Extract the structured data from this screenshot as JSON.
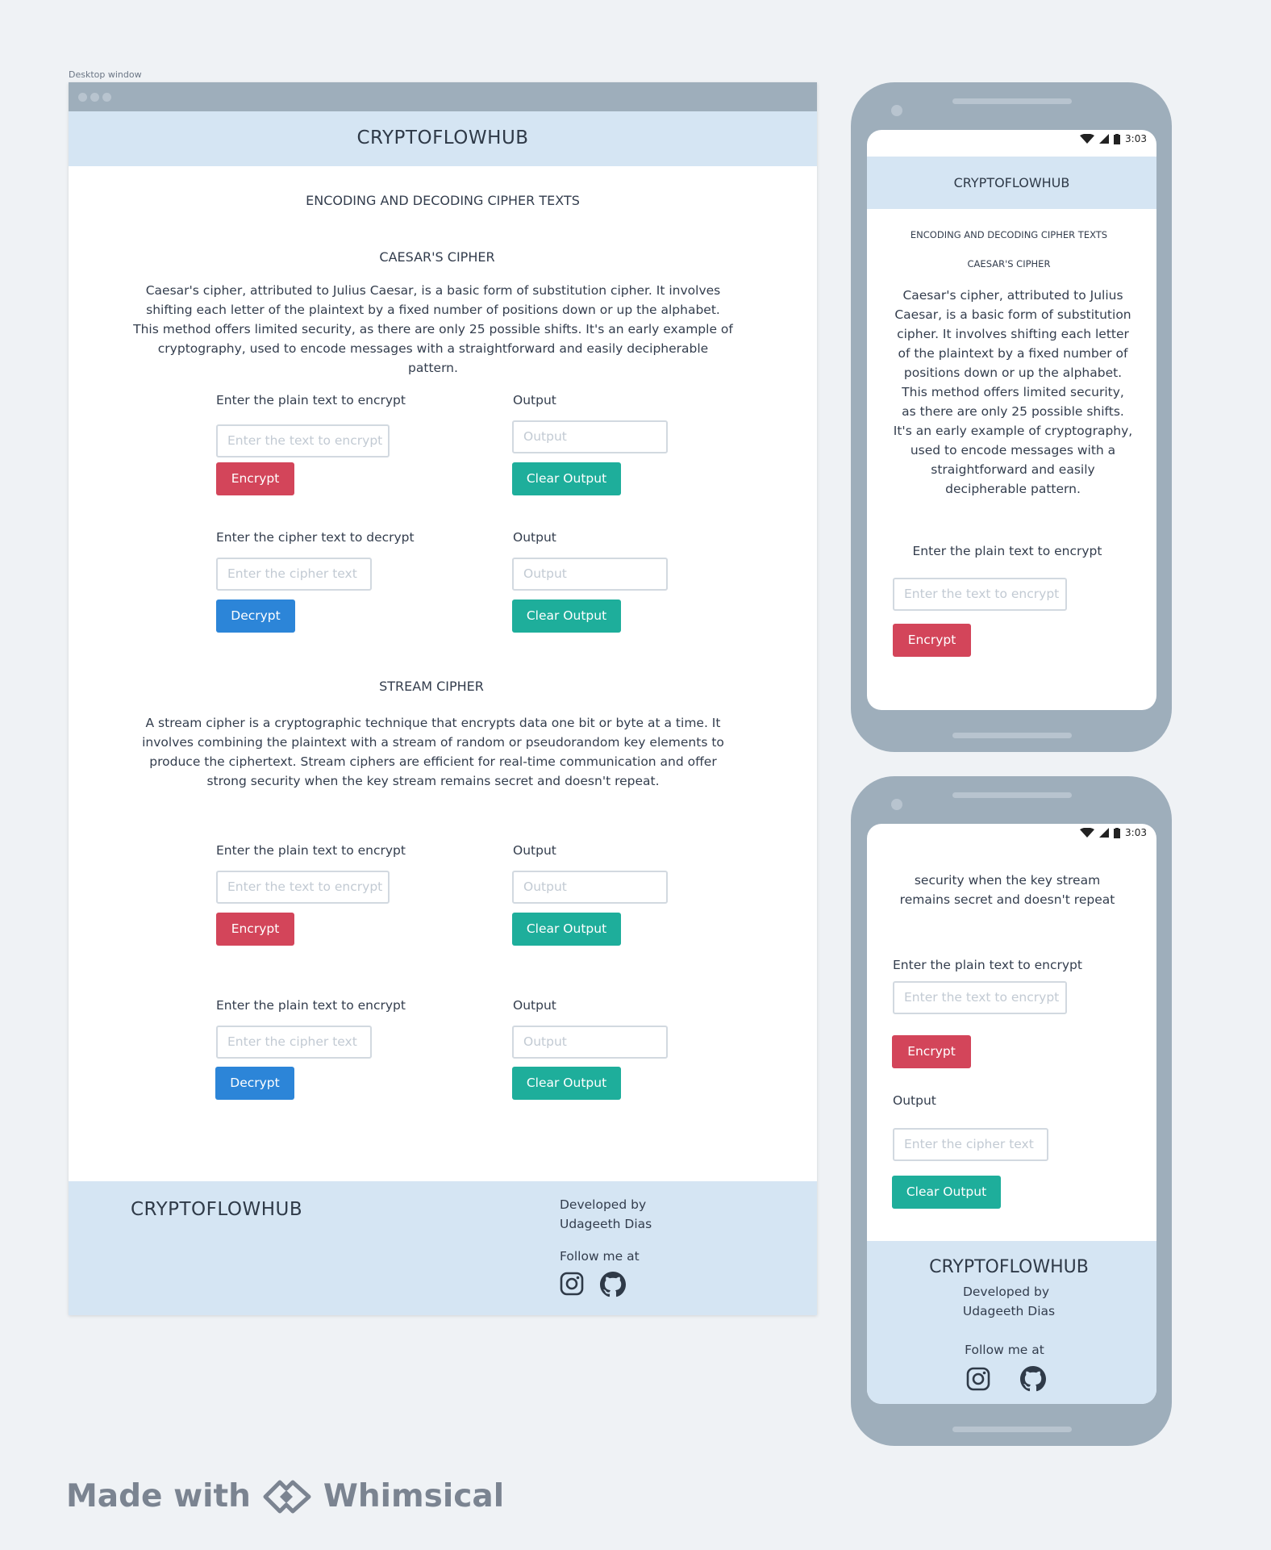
{
  "desktop": {
    "caption": "Desktop window",
    "brand": "CRYPTOFLOWHUB",
    "page_heading": "ENCODING AND DECODING CIPHER TEXTS",
    "caesar": {
      "title": "CAESAR'S CIPHER",
      "description": "Caesar's cipher, attributed to Julius Caesar, is a basic form of substitution cipher. It involves shifting each letter of the plaintext by a fixed number of positions down or up the alphabet. This method offers limited security, as there are only 25 possible shifts. It's an early example of cryptography, used to encode messages with a straightforward and easily decipherable pattern.",
      "encrypt_label": "Enter the plain text to encrypt",
      "encrypt_placeholder": "Enter the text to encrypt",
      "encrypt_button": "Encrypt",
      "output_label": "Output",
      "output_placeholder": "Output",
      "clear_button": "Clear Output",
      "decrypt_label": "Enter the cipher text to decrypt",
      "decrypt_placeholder": "Enter the cipher text",
      "decrypt_button": "Decrypt",
      "output2_label": "Output",
      "output2_placeholder": "Output",
      "clear2_button": "Clear Output"
    },
    "stream": {
      "title": "STREAM CIPHER",
      "description": "A stream cipher is a cryptographic technique that encrypts data one bit or byte at a time. It involves combining the plaintext with a stream of random or pseudorandom key elements to produce the ciphertext. Stream ciphers are efficient for real-time communication and offer strong security when the key stream remains secret and doesn't repeat.",
      "encrypt_label": "Enter the plain text to encrypt",
      "encrypt_placeholder": "Enter the text to encrypt",
      "encrypt_button": "Encrypt",
      "output_label": "Output",
      "output_placeholder": "Output",
      "clear_button": "Clear Output",
      "decrypt_label": "Enter the plain text to encrypt",
      "decrypt_placeholder": "Enter the cipher text",
      "decrypt_button": "Decrypt",
      "output2_label": "Output",
      "output2_placeholder": "Output",
      "clear2_button": "Clear Output"
    },
    "footer": {
      "brand": "CRYPTOFLOWHUB",
      "developed_by": "Developed by",
      "developer": "Udageeth Dias",
      "follow": "Follow me at",
      "icons": [
        "instagram-icon",
        "github-icon"
      ]
    }
  },
  "phone1": {
    "time": "3:03",
    "brand": "CRYPTOFLOWHUB",
    "page_heading": "ENCODING AND DECODING CIPHER TEXTS",
    "section_title": "CAESAR'S CIPHER",
    "description": "Caesar's cipher, attributed to Julius Caesar, is a basic form of substitution cipher. It involves shifting each letter of the plaintext by a fixed number of positions down or up the alphabet. This method offers limited security, as there are only 25 possible shifts. It's an early example of cryptography, used to encode messages with a straightforward and easily decipherable pattern.",
    "encrypt_label": "Enter the plain text to encrypt",
    "encrypt_placeholder": "Enter the text to encrypt",
    "encrypt_button": "Encrypt"
  },
  "phone2": {
    "time": "3:03",
    "description_tail": "security when the key stream remains secret and doesn't repeat",
    "encrypt_label": "Enter the plain text to encrypt",
    "encrypt_placeholder": "Enter the text to encrypt",
    "encrypt_button": "Encrypt",
    "output_label": "Output",
    "output_placeholder": "Enter the cipher text",
    "clear_button": "Clear Output",
    "footer": {
      "brand": "CRYPTOFLOWHUB",
      "developed_by": "Developed by",
      "developer": "Udageeth Dias",
      "follow": "Follow me at"
    }
  },
  "watermark": {
    "made_with": "Made with",
    "product": "Whimsical"
  },
  "colors": {
    "header_bg": "#d5e5f3",
    "encrypt": "#d3455a",
    "clear": "#1eae9b",
    "decrypt": "#2c85d8",
    "frame": "#9eaebb"
  }
}
